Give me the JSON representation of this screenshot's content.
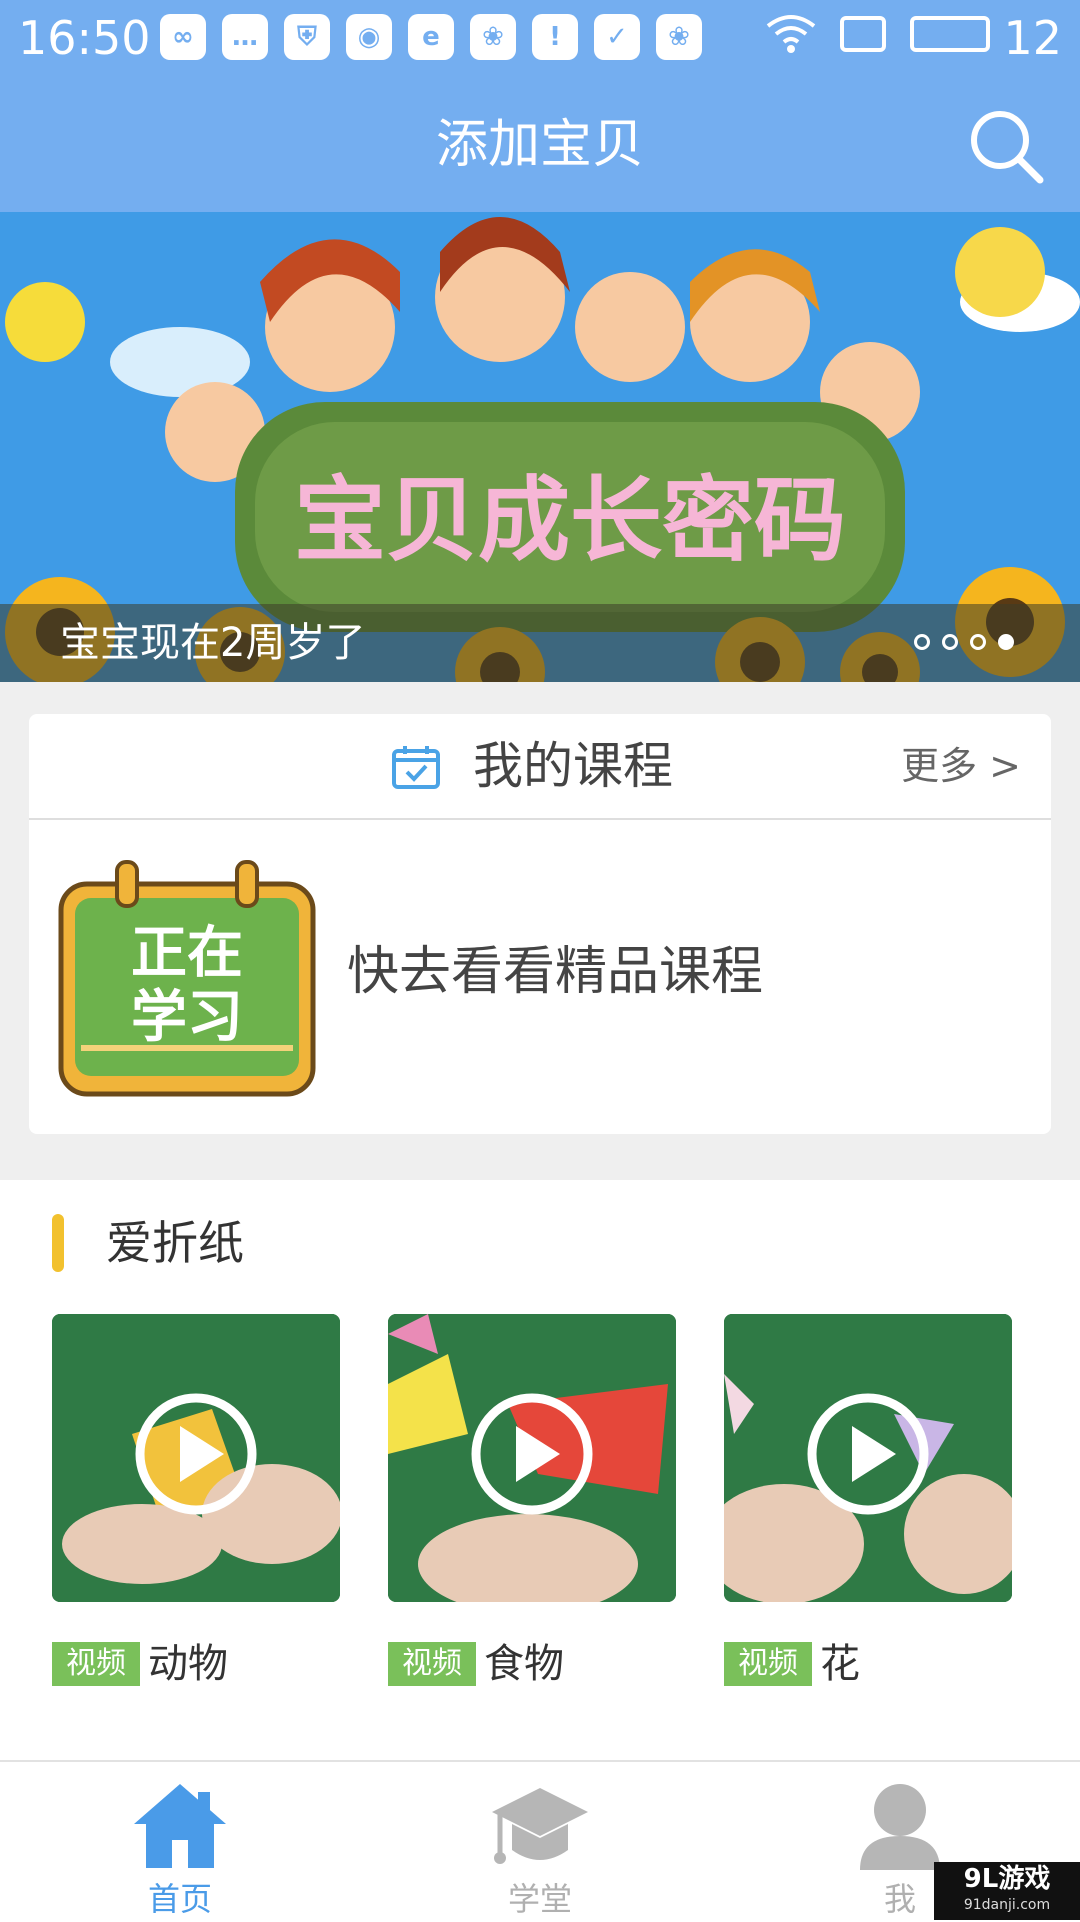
{
  "status_bar": {
    "time": "16:50",
    "battery_level": "12",
    "icons": [
      "infinity-icon",
      "chat-icon",
      "shield-icon",
      "weibo-icon",
      "browser-icon",
      "uc-icon",
      "alert-icon",
      "check-icon",
      "squirrel-icon"
    ]
  },
  "header": {
    "title": "添加宝贝",
    "search_icon": "search-icon"
  },
  "banner": {
    "image_text": "宝贝成长密码",
    "caption": "宝宝现在2周岁了",
    "slide_count": 4,
    "active_slide": 4
  },
  "my_courses": {
    "title": "我的课程",
    "more": "更多 >",
    "badge_text": [
      "正在",
      "学习"
    ],
    "prompt": "快去看看精品课程"
  },
  "origami_section": {
    "title": "爱折纸",
    "videos": [
      {
        "tag": "视频",
        "name": "动物"
      },
      {
        "tag": "视频",
        "name": "食物"
      },
      {
        "tag": "视频",
        "name": "花"
      }
    ]
  },
  "tab_bar": {
    "tabs": [
      {
        "label": "首页",
        "icon": "home-icon",
        "active": true
      },
      {
        "label": "学堂",
        "icon": "graduation-cap-icon",
        "active": false
      },
      {
        "label": "我",
        "icon": "person-icon",
        "active": false
      }
    ]
  },
  "watermark": {
    "main": "9L游戏",
    "sub": "91danji.com"
  },
  "colors": {
    "header_blue": "#74aef0",
    "tab_active_blue": "#4a9be8",
    "tag_green": "#7ac05a",
    "section_accent_yellow": "#f2c12e"
  }
}
